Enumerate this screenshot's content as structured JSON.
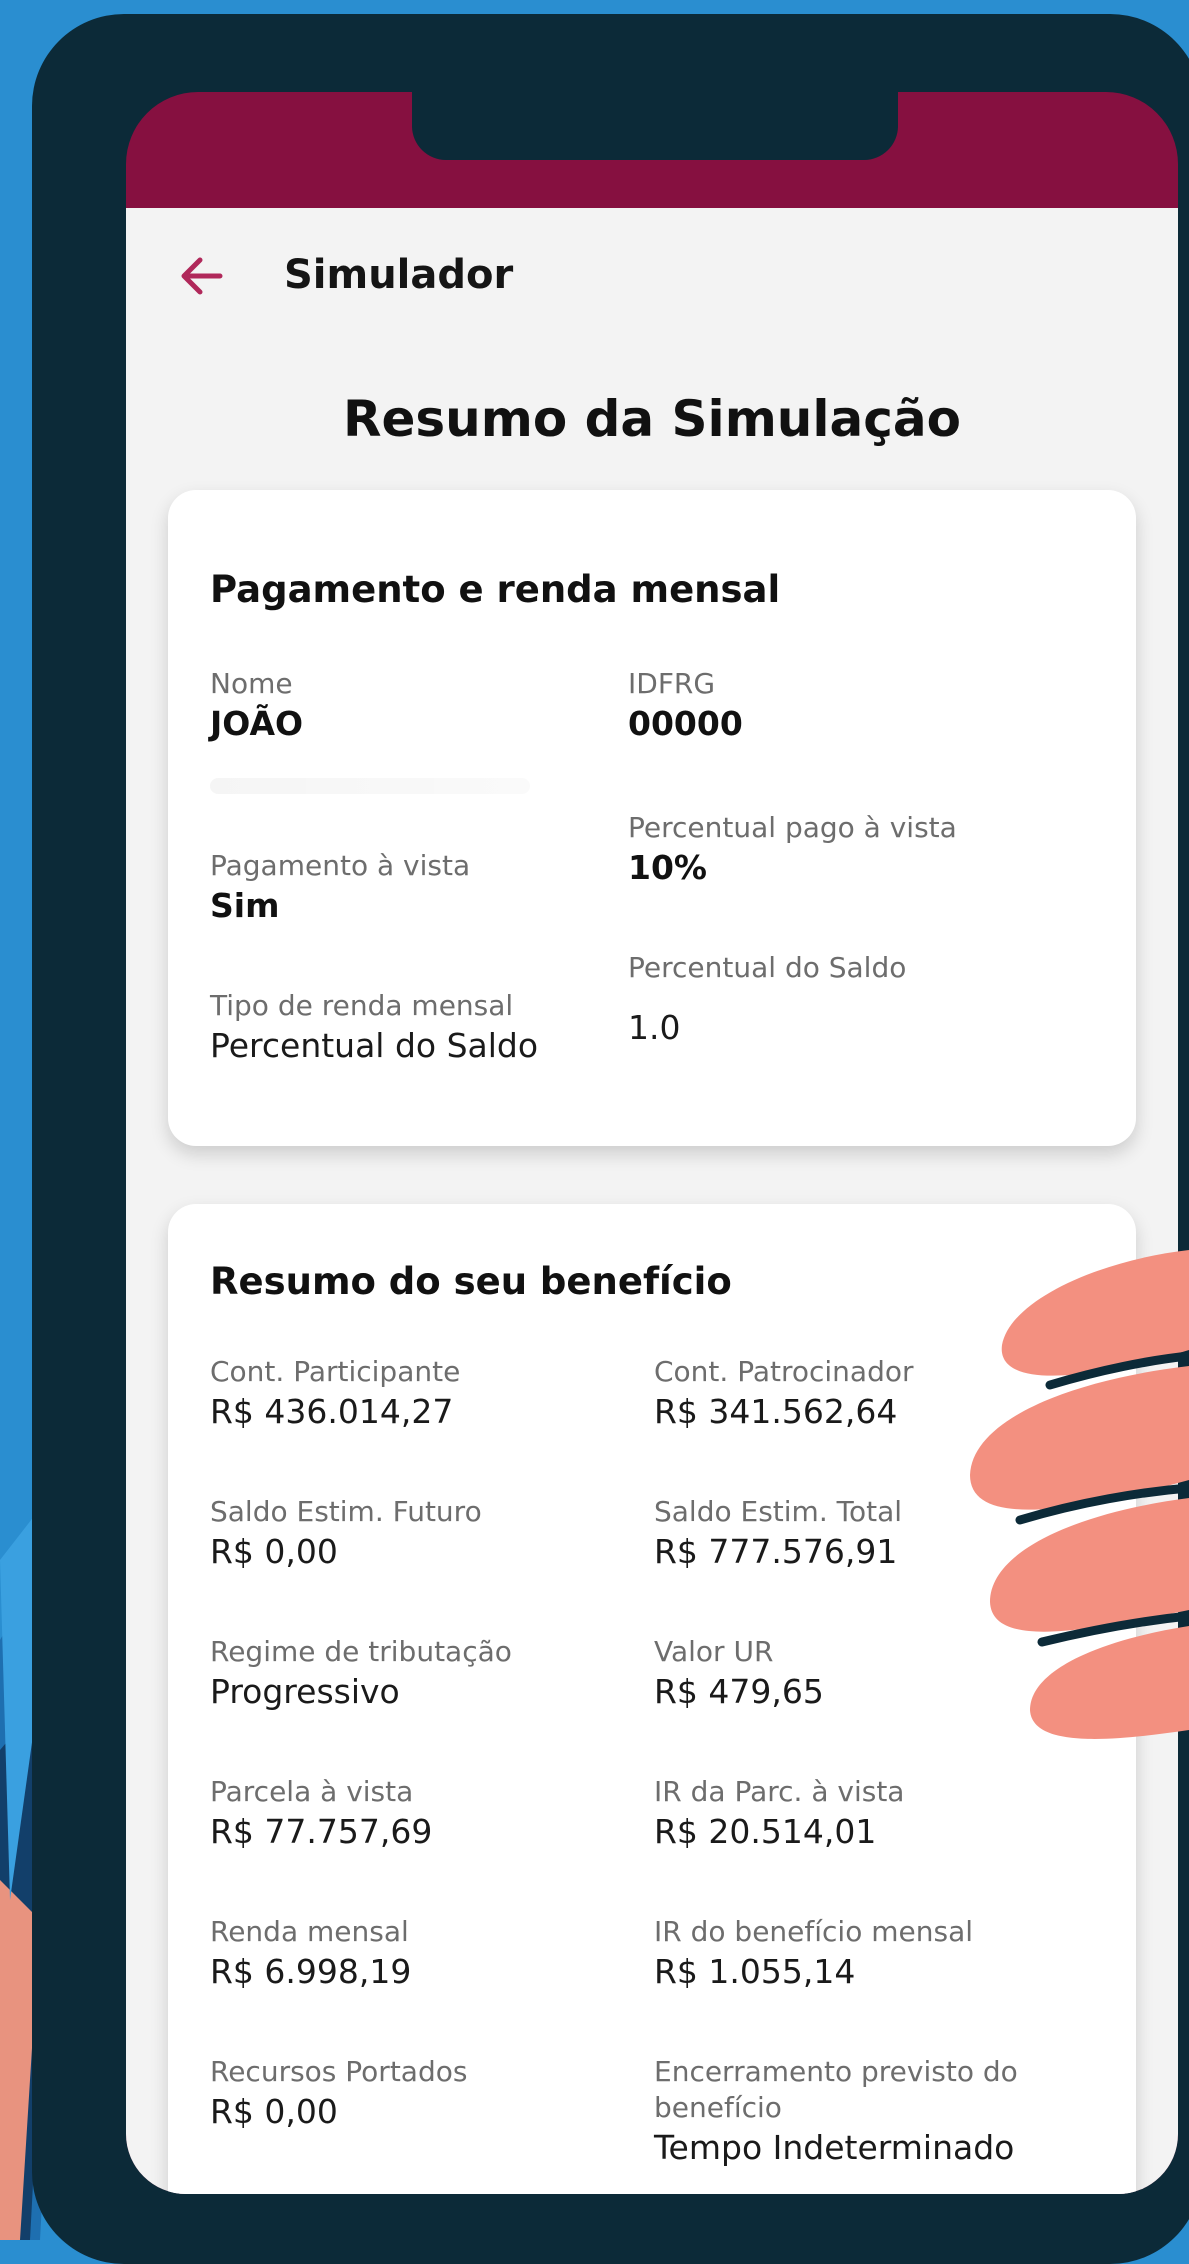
{
  "header": {
    "title": "Simulador"
  },
  "page_title": "Resumo da Simulação",
  "payment_card": {
    "title": "Pagamento e renda mensal",
    "fields": [
      {
        "label": "Nome",
        "value": "JOÃO"
      },
      {
        "label": "IDFRG",
        "value": "00000"
      },
      {
        "label": "Percentual pago à vista",
        "value": "10%"
      },
      {
        "label": "Pagamento à vista",
        "value": "Sim"
      },
      {
        "label": "Percentual do Saldo",
        "value": "1.0"
      },
      {
        "label": "Tipo de renda mensal",
        "value": "Percentual do Saldo"
      }
    ]
  },
  "benefit_card": {
    "title": "Resumo do seu benefício",
    "fields": [
      {
        "label": "Cont. Participante",
        "value": "R$ 436.014,27"
      },
      {
        "label": "Cont. Patrocinador",
        "value": "R$ 341.562,64"
      },
      {
        "label": "Saldo Estim. Futuro",
        "value": "R$ 0,00"
      },
      {
        "label": "Saldo Estim. Total",
        "value": "R$ 777.576,91"
      },
      {
        "label": "Regime de tributação",
        "value": "Progressivo"
      },
      {
        "label": "Valor UR",
        "value": "R$ 479,65"
      },
      {
        "label": "Parcela à vista",
        "value": "R$ 77.757,69"
      },
      {
        "label": "IR da Parc. à vista",
        "value": "R$ 20.514,01"
      },
      {
        "label": "Renda mensal",
        "value": "R$ 6.998,19"
      },
      {
        "label": "IR do benefício mensal",
        "value": "R$ 1.055,14"
      },
      {
        "label": "Recursos Portados",
        "value": "R$ 0,00"
      },
      {
        "label": "Encerramento previsto do benefício",
        "value": "Tempo Indeterminado"
      }
    ]
  },
  "colors": {
    "accent": "#861040",
    "background": "#2a8ed0",
    "frame": "#0c2a38",
    "hand": "#f39080"
  },
  "icons": {
    "back": "arrow-left-icon"
  }
}
